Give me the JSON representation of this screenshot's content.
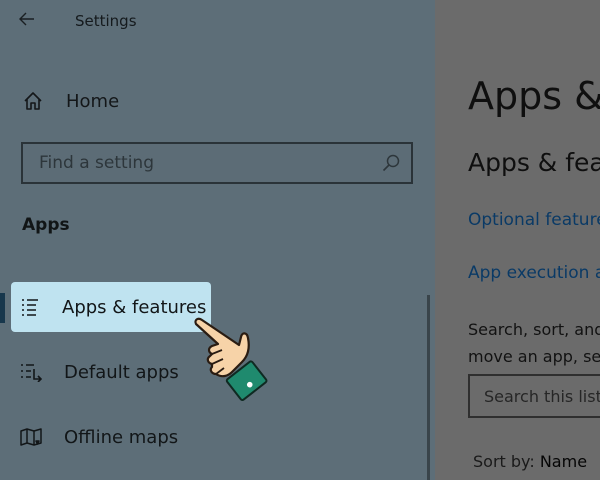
{
  "window": {
    "title": "Settings"
  },
  "sidebar": {
    "home_label": "Home",
    "search_placeholder": "Find a setting",
    "section_heading": "Apps",
    "items": [
      {
        "label": "Apps & features",
        "icon": "apps-features-icon",
        "selected": true
      },
      {
        "label": "Default apps",
        "icon": "default-apps-icon",
        "selected": false
      },
      {
        "label": "Offline maps",
        "icon": "offline-maps-icon",
        "selected": false
      }
    ]
  },
  "content": {
    "page_title": "Apps & features",
    "section_title": "Apps & features",
    "links": [
      "Optional features",
      "App execution aliases"
    ],
    "description_line1": "Search, sort, and filter by drive. If you would like to uninstall or",
    "description_line2": "move an app, select it from the list.",
    "list_search_placeholder": "Search this list",
    "sort_label": "Sort by:",
    "sort_value": "Name"
  },
  "colors": {
    "sidebar_bg": "#5d6e78",
    "selected_bg": "#bfe3f0",
    "accent_bar": "#17374c",
    "link": "#0a3a66",
    "content_bg": "#6b6b6b"
  }
}
